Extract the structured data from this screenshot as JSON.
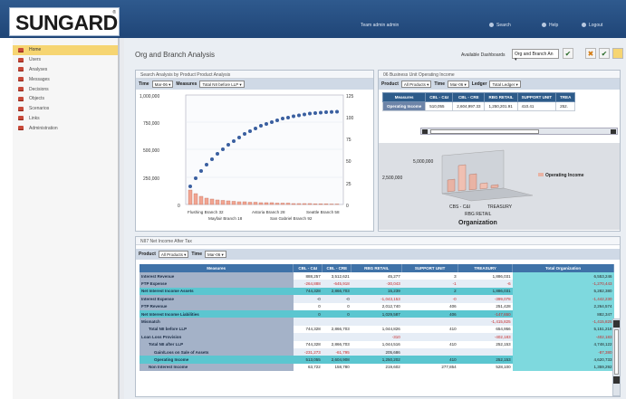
{
  "header": {
    "logo": "SUNGARD",
    "logo_tm": "®",
    "user": "Team admin admin",
    "nav": [
      "Search",
      "Help",
      "Logout"
    ]
  },
  "sidebar": {
    "items": [
      {
        "label": "Home",
        "active": true
      },
      {
        "label": "Users"
      },
      {
        "label": "Analyses"
      },
      {
        "label": "Messages"
      },
      {
        "label": "Decisions"
      },
      {
        "label": "Objects"
      },
      {
        "label": "Scenarios"
      },
      {
        "label": "Links"
      },
      {
        "label": "Administration"
      }
    ]
  },
  "main": {
    "title": "Org and Branch Analysis",
    "dashboards_label": "Available Dashboards",
    "dashboard_selected": "Org and Branch An"
  },
  "panel_search": {
    "title": "Search Analysis by Product Product Analysis",
    "time_label": "Time",
    "time_value": "Mar-06",
    "measures_label": "Measures",
    "measures_value": "Total NII before LLP",
    "chart_yticks_left": [
      "1,000,000",
      "750,000",
      "500,000",
      "250,000",
      "0"
    ],
    "chart_yticks_right": [
      "125",
      "100",
      "75",
      "50",
      "25",
      "0"
    ],
    "chart_xlabels_row1": [
      "Flushing Branch 32",
      "Astoria Branch 28",
      "Seattle Branch 58"
    ],
    "chart_xlabels_row2": [
      "Mayfair Branch 18",
      "San Gabriel Branch 92"
    ]
  },
  "panel_income": {
    "title": "06 Business Unit Operating Income",
    "product_label": "Product",
    "product_value": "All Products",
    "time_label": "Time",
    "time_value": "Mar-06",
    "ledger_label": "Ledger",
    "ledger_value": "Total Ledger",
    "columns": [
      "Measures",
      "CBL - C&I",
      "CBL - CRE",
      "RBG RETAIL",
      "SUPPORT UNIT",
      "TREA"
    ],
    "row_label": "Operating Income",
    "row_values": [
      "510,055",
      "2,604,997.33",
      "1,250,201.91",
      "410.41",
      "252."
    ],
    "chart_tick": "5,000,000",
    "chart_tick2": "2,500,000",
    "chart_cats": [
      "CBS - C&I",
      "TREASURY"
    ],
    "chart_cat3": "RBG RETAIL",
    "chart_xlabel": "Organization",
    "legend": "Operating Income"
  },
  "panel_nii": {
    "title": "NII7 Net Income After Tax",
    "product_label": "Product",
    "product_value": "All Products",
    "time_label": "Time",
    "time_value": "Mar-06",
    "columns": [
      "Measures",
      "CBL - C&I",
      "CBL - CRE",
      "RBG RETAIL",
      "SUPPORT UNIT",
      "TREASURY",
      "Total Organization"
    ],
    "rows": [
      {
        "label": "Interest Revenue",
        "vals": [
          "888,257",
          "3,512,621",
          "45,277",
          "3",
          "1,886,031",
          "6,553,246"
        ],
        "neg": [],
        "style": ""
      },
      {
        "label": "FTP Expense",
        "vals": [
          "-264,888",
          "-645,918",
          "-30,043",
          "-1",
          "-6",
          "-1,270,443"
        ],
        "neg": [
          0,
          1,
          2,
          3,
          4,
          5
        ],
        "style": "alt"
      },
      {
        "label": "Net Interest Income Assets",
        "vals": [
          "744,328",
          "2,866,703",
          "15,239",
          "2",
          "1,886,031",
          "5,282,380"
        ],
        "neg": [],
        "style": "hl"
      },
      {
        "label": "Interest Expense",
        "vals": [
          "-0",
          "-0",
          "-1,043,153",
          "-0",
          "-399,078",
          "-1,442,230"
        ],
        "neg": [
          2,
          3,
          4,
          5
        ],
        "style": "alt"
      },
      {
        "label": "FTP Revenue",
        "vals": [
          "0",
          "0",
          "2,012,740",
          "406",
          "251,428",
          "2,264,574"
        ],
        "neg": [],
        "style": ""
      },
      {
        "label": "Net Interest Income Liabilities",
        "vals": [
          "0",
          "0",
          "1,029,587",
          "406",
          "-147,650",
          "882,347"
        ],
        "neg": [
          4
        ],
        "style": "hl"
      },
      {
        "label": "Mismatch",
        "vals": [
          "",
          "",
          "",
          "",
          "-1,415,825",
          "-1,415,825"
        ],
        "neg": [
          4,
          5
        ],
        "style": "alt"
      },
      {
        "label": "Total NII before LLP",
        "vals": [
          "744,328",
          "2,866,703",
          "1,044,826",
          "410",
          "654,956",
          "5,151,218"
        ],
        "neg": [],
        "style": ""
      },
      {
        "label": "Loan Loss Provision",
        "vals": [
          "",
          "",
          "-310",
          "",
          "-402,183",
          "-402,183"
        ],
        "neg": [
          2,
          4,
          5
        ],
        "style": "alt"
      },
      {
        "label": "Total NII after LLP",
        "vals": [
          "744,328",
          "2,866,703",
          "1,044,516",
          "410",
          "252,153",
          "4,748,122"
        ],
        "neg": [],
        "style": ""
      },
      {
        "label": "Gain/Loss on Sale of Assets",
        "vals": [
          "-231,273",
          "-61,795",
          "205,686",
          "",
          "",
          "-87,380"
        ],
        "neg": [
          0,
          1,
          5
        ],
        "style": "alt"
      },
      {
        "label": "Operating Income",
        "vals": [
          "513,055",
          "2,604,908",
          "1,250,202",
          "410",
          "252,153",
          "4,620,733"
        ],
        "neg": [],
        "style": "hl"
      },
      {
        "label": "Non Interest Income",
        "vals": [
          "63,722",
          "158,780",
          "219,602",
          "277,854",
          "528,100",
          "1,359,292"
        ],
        "neg": [],
        "style": ""
      }
    ]
  }
}
